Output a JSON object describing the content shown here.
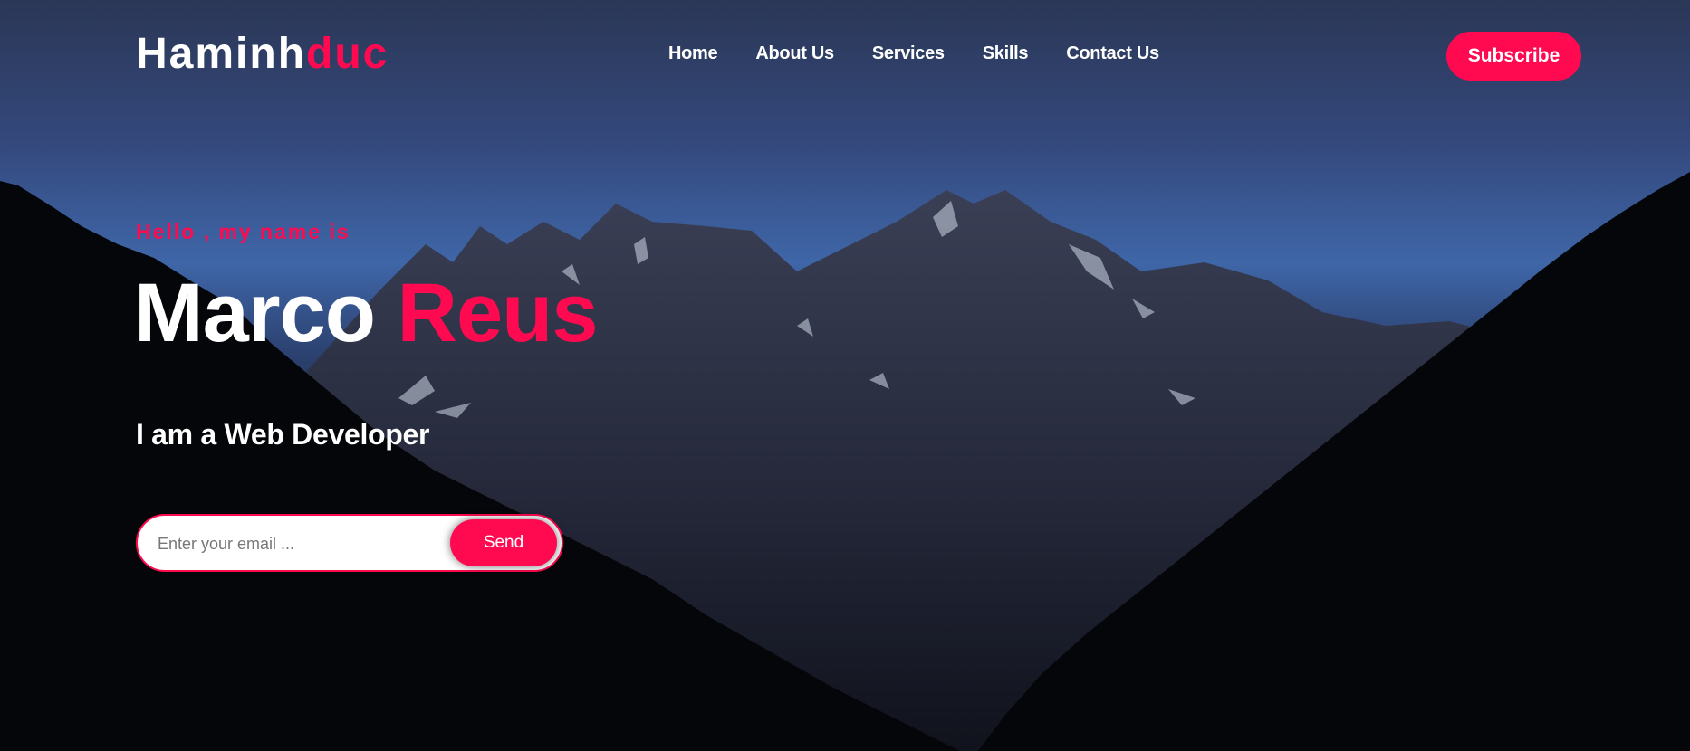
{
  "logo": {
    "main": "Haminh",
    "accent": "duc"
  },
  "nav": {
    "items": [
      {
        "label": "Home"
      },
      {
        "label": "About Us"
      },
      {
        "label": "Services"
      },
      {
        "label": "Skills"
      },
      {
        "label": "Contact Us"
      }
    ],
    "subscribe_label": "Subscribe"
  },
  "hero": {
    "greeting": "Hello , my name is",
    "first_name": "Marco",
    "last_name": "Reus",
    "role": "I am a Web Developer",
    "background": "mountain-night-photo"
  },
  "form": {
    "email_placeholder": "Enter your email ...",
    "email_value": "",
    "send_label": "Send"
  },
  "colors": {
    "accent": "#ff0a50",
    "text": "#ffffff",
    "sky_top": "#2b3756",
    "sky_mid": "#3f66a8"
  }
}
